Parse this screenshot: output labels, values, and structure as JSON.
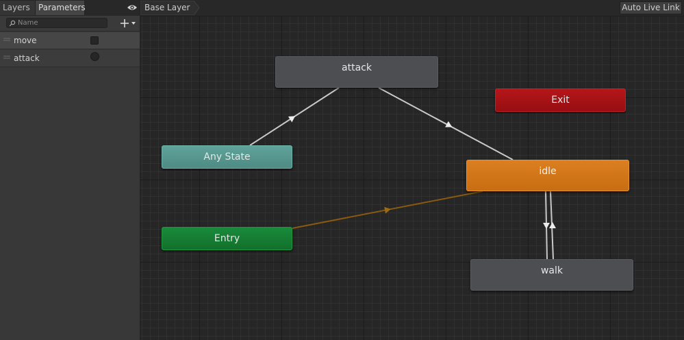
{
  "left_panel": {
    "tabs": [
      {
        "label": "Layers"
      },
      {
        "label": "Parameters"
      }
    ],
    "search": {
      "placeholder": "Name",
      "value": ""
    },
    "parameters": [
      {
        "name": "move",
        "type": "bool"
      },
      {
        "name": "attack",
        "type": "trigger"
      }
    ]
  },
  "graph": {
    "breadcrumb": "Base Layer",
    "auto_live_link_label": "Auto Live Link",
    "states": {
      "attack": "attack",
      "any_state": "Any State",
      "entry": "Entry",
      "exit": "Exit",
      "idle": "idle",
      "walk": "walk"
    },
    "transitions": [
      {
        "from": "Any State",
        "to": "attack"
      },
      {
        "from": "attack",
        "to": "idle"
      },
      {
        "from": "Entry",
        "to": "idle"
      },
      {
        "from": "idle",
        "to": "walk"
      },
      {
        "from": "walk",
        "to": "idle"
      }
    ]
  },
  "colors": {
    "entry": "#1a8a3a",
    "exit": "#b5161a",
    "any_state": "#5fa39a",
    "default_state": "#d47818",
    "state": "#4d4e52",
    "entry_transition": "#8a5a0e"
  }
}
